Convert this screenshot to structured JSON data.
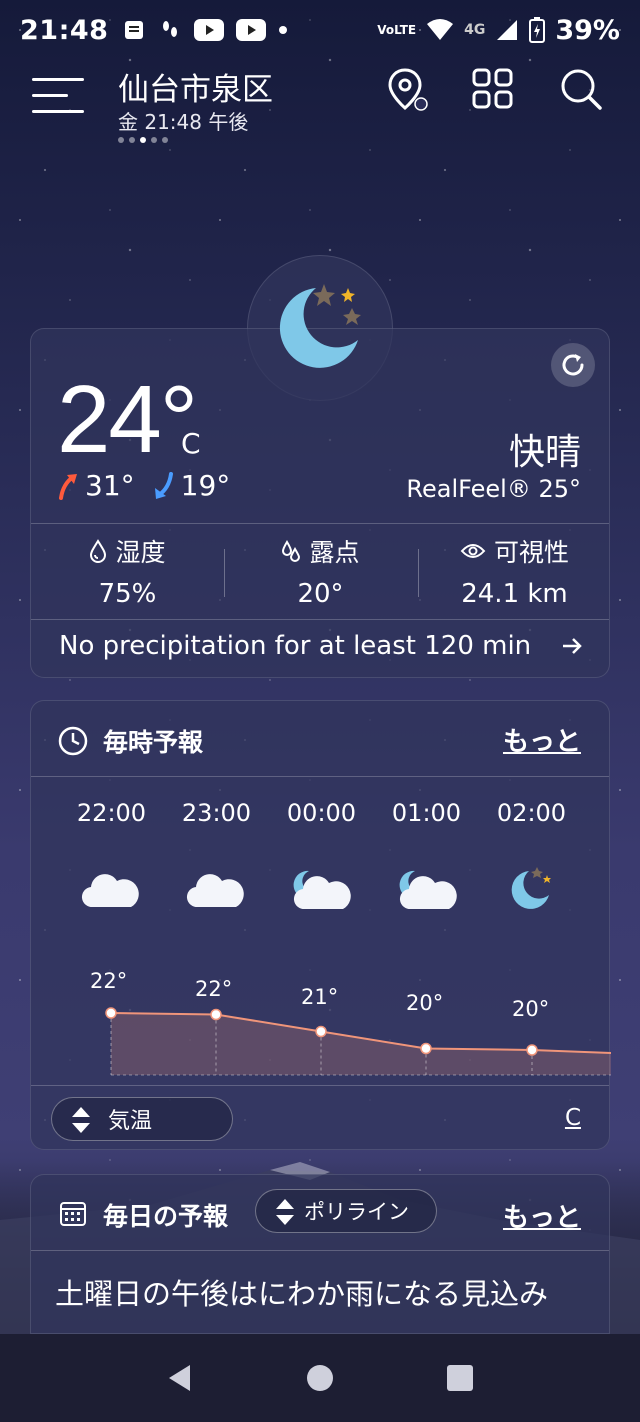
{
  "status": {
    "time": "21:48",
    "network": "4G",
    "volte": "VoLTE",
    "battery": "39%"
  },
  "header": {
    "city": "仙台市泉区",
    "subtitle": "金 21:48 午後"
  },
  "current": {
    "temperature": "24°",
    "unit": "C",
    "high": "31°",
    "low": "19°",
    "condition": "快晴",
    "realfeel": "RealFeel® 25°",
    "humidity_label": "湿度",
    "humidity_value": "75%",
    "dewpoint_label": "露点",
    "dewpoint_value": "20°",
    "visibility_label": "可視性",
    "visibility_value": "24.1 km",
    "precip_text": "No precipitation for at least 120 min"
  },
  "hourly": {
    "title": "毎時予報",
    "more": "もっと",
    "hours": [
      "22:00",
      "23:00",
      "00:00",
      "01:00",
      "02:00"
    ],
    "icons": [
      "cloud-icon",
      "cloud-icon",
      "moon-cloud-icon",
      "moon-cloud-icon",
      "moon-stars-icon"
    ],
    "temps": [
      "22°",
      "22°",
      "21°",
      "20°",
      "20°"
    ],
    "temp_values": [
      22,
      22,
      21,
      20,
      20
    ],
    "toggle_label": "気温",
    "unit_label": "C"
  },
  "daily": {
    "title": "毎日の予報",
    "toggle_label": "ポリライン",
    "more": "もっと",
    "headline": "土曜日の午後はにわか雨になる見込み"
  },
  "colors": {
    "accent_line": "#f0957a",
    "moon": "#7fc8e8",
    "up_arrow": "#ff5a3c",
    "down_arrow": "#4a9cff"
  }
}
